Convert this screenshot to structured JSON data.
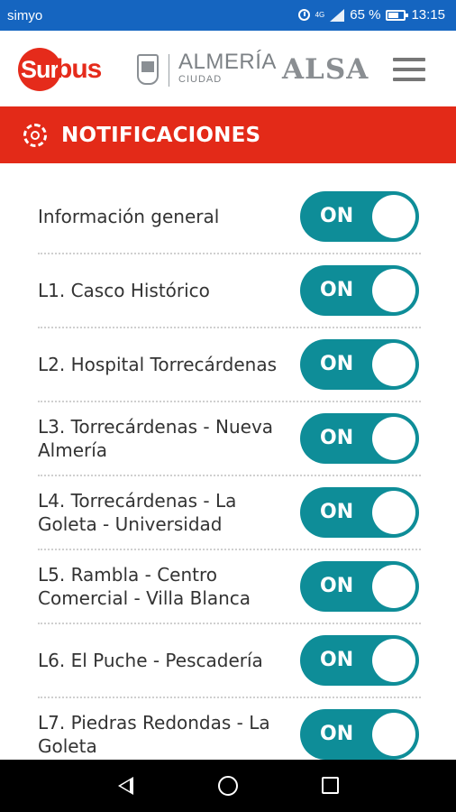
{
  "status_bar": {
    "carrier": "simyo",
    "network_label": "4G",
    "battery_percent": "65 %",
    "time": "13:15"
  },
  "header": {
    "logo_surbus_part1": "Sur",
    "logo_surbus_part2": "bus",
    "city_name": "ALMERÍA",
    "city_sub": "CIUDAD",
    "operator": "ALSA",
    "icons": [
      "crest-icon",
      "menu-icon"
    ]
  },
  "title_bar": {
    "title": "NOTIFICACIONES",
    "icon": "gear-icon",
    "color": "#e32a18"
  },
  "notifications": {
    "toggle_color": "#0e8d98",
    "items": [
      {
        "label": "Información general",
        "state": "ON"
      },
      {
        "label": "L1. Casco Histórico",
        "state": "ON"
      },
      {
        "label": "L2. Hospital Torrecárdenas",
        "state": "ON"
      },
      {
        "label": "L3. Torrecárdenas - Nueva Almería",
        "state": "ON"
      },
      {
        "label": "L4. Torrecárdenas - La Goleta - Universidad",
        "state": "ON"
      },
      {
        "label": "L5. Rambla - Centro Comercial - Villa Blanca",
        "state": "ON"
      },
      {
        "label": "L6. El Puche - Pescadería",
        "state": "ON"
      },
      {
        "label": "L7. Piedras Redondas - La Goleta",
        "state": "ON"
      }
    ]
  },
  "nav_bar": {
    "icons": [
      "back-icon",
      "home-icon",
      "recent-apps-icon"
    ]
  }
}
